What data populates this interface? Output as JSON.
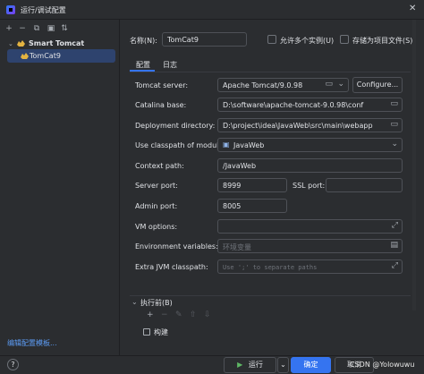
{
  "window": {
    "title": "运行/调试配置",
    "close_glyph": "✕"
  },
  "left_panel": {
    "toolbar_icons": [
      "+",
      "−",
      "⧉",
      "▣",
      "⇅"
    ],
    "tree_root": "Smart Tomcat",
    "tree_child": "TomCat9",
    "edit_templates_link": "编辑配置模板..."
  },
  "header": {
    "name_label": "名称(N):",
    "name_value": "TomCat9",
    "allow_parallel": "允许多个实例(U)",
    "store_as_project_file": "存储为项目文件(S)"
  },
  "tabs": [
    "配置",
    "日志"
  ],
  "form": {
    "tomcat_server_label": "Tomcat server:",
    "tomcat_server_value": "Apache Tomcat/9.0.98",
    "configure_button": "Configure...",
    "catalina_base_label": "Catalina base:",
    "catalina_base_value": "D:\\software\\apache-tomcat-9.0.98\\conf",
    "deployment_dir_label": "Deployment directory:",
    "deployment_dir_value": "D:\\project\\idea\\JavaWeb\\src\\main\\webapp",
    "classpath_module_label": "Use classpath of module:",
    "classpath_module_value": "JavaWeb",
    "context_path_label": "Context path:",
    "context_path_value": "/JavaWeb",
    "server_port_label": "Server port:",
    "server_port_value": "8999",
    "ssl_port_label": "SSL port:",
    "ssl_port_value": "",
    "admin_port_label": "Admin port:",
    "admin_port_value": "8005",
    "vm_options_label": "VM options:",
    "vm_options_value": "",
    "env_vars_label": "Environment variables:",
    "env_vars_placeholder": "环境变量",
    "extra_jvm_label": "Extra JVM classpath:",
    "extra_jvm_placeholder": "Use ';' to separate paths"
  },
  "before_launch": {
    "title": "执行前(B)",
    "toolbar_icons": [
      "+",
      "−",
      "✎",
      "⇧",
      "⇩"
    ],
    "build_item": "构建"
  },
  "footer": {
    "help": "?",
    "run_button": "运行",
    "ok_button": "确定",
    "cancel_button": "取消",
    "watermark": "CSDN @Yolowuwu"
  },
  "colors": {
    "accent": "#3574f0",
    "background": "#2b2d30",
    "selection": "#2e436e",
    "link": "#5c9cf5",
    "run_icon": "#5fb865"
  },
  "icons": {
    "folder": "folder-icon",
    "expand": "expand-icon",
    "tomcat": "tomcat-icon",
    "module": "module-icon"
  }
}
